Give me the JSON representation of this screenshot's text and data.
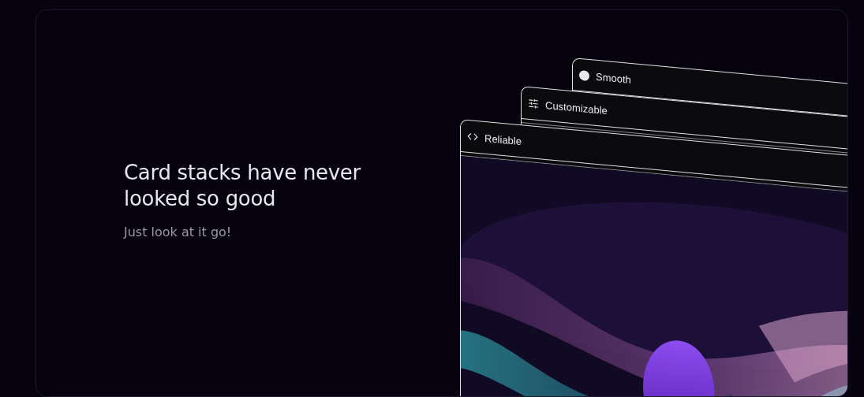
{
  "hero": {
    "heading": "Card stacks have never looked so good",
    "subheading": "Just look at it go!"
  },
  "cards": [
    {
      "kind": "dot",
      "title": "Smooth"
    },
    {
      "kind": "sliders",
      "title": "Customizable"
    },
    {
      "kind": "code",
      "title": "Reliable"
    }
  ]
}
